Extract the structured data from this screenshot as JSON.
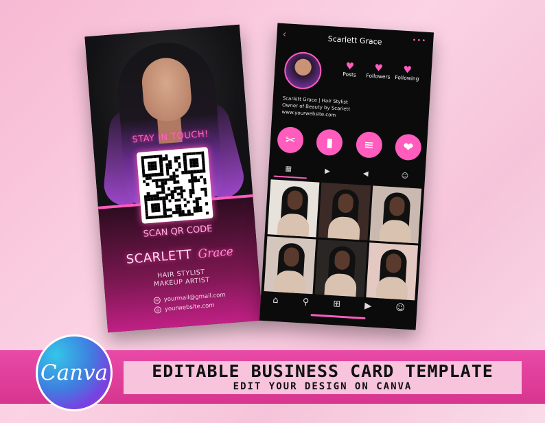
{
  "front_card": {
    "stay_text": "STAY IN TOUCH!",
    "scan_text": "SCAN QR CODE",
    "name_first": "SCARLETT",
    "name_last": "Grace",
    "role_1": "HAIR STYLIST",
    "role_2": "MAKEUP ARTIST",
    "email": "yourmail@gmail.com",
    "website": "yourwebsite.com"
  },
  "back_card": {
    "back_arrow": "‹",
    "profile_name": "Scarlett Grace",
    "menu_dots": "•••",
    "stats": [
      {
        "label": "Posts"
      },
      {
        "label": "Followers"
      },
      {
        "label": "Following"
      }
    ],
    "bio_line_1": "Scarlett Grace | Hair Stylist",
    "bio_line_2": "Owner of Beauty by Scariett",
    "bio_line_3": "www.yourwebsite.com",
    "highlight_icons": [
      "scissors-icon",
      "lipstick-icon",
      "comb-icon",
      "lips-icon"
    ],
    "highlight_glyphs": [
      "✂",
      "▮",
      "≡",
      "❤"
    ],
    "tabs": [
      "▦",
      "▶",
      "◀",
      "☺"
    ],
    "nav": [
      "⌂",
      "⚲",
      "⊞",
      "▶",
      "☺"
    ],
    "photo_backgrounds": [
      "#e8e2dc",
      "#3b2a26",
      "#c9b9b0",
      "#d4c6bd",
      "#2a2624",
      "#e3c9c2"
    ]
  },
  "banner": {
    "title": "EDITABLE BUSINESS CARD TEMPLATE",
    "subtitle": "EDIT YOUR DESIGN ON CANVA"
  },
  "canva": {
    "label": "Canva"
  },
  "colors": {
    "accent_pink": "#ff5cbd",
    "banner_pink": "#e94aa7"
  }
}
